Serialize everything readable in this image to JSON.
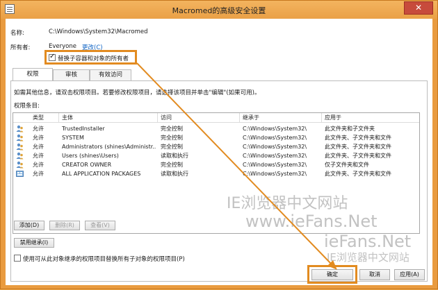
{
  "window": {
    "title": "Macromed的高级安全设置",
    "close_glyph": "✕"
  },
  "info": {
    "name_label": "名称:",
    "name_value": "C:\\Windows\\System32\\Macromed",
    "owner_label": "所有者:",
    "owner_value": "Everyone",
    "change_link": "更改(C)",
    "replace_owner_label": "替换子容器和对象的所有者",
    "replace_owner_checked": true
  },
  "tabs": [
    {
      "label": "权限",
      "active": true
    },
    {
      "label": "审核",
      "active": false
    },
    {
      "label": "有效访问",
      "active": false
    }
  ],
  "instructions": "如需其他信息，请双击权限项目。若要修改权限项目，请选择该项目并单击\"编辑\"(如果可用)。",
  "entries_label": "权限条目:",
  "columns": [
    "类型",
    "主体",
    "访问",
    "继承于",
    "应用于"
  ],
  "rows": [
    {
      "type": "允许",
      "principal": "TrustedInstaller",
      "access": "完全控制",
      "inherited": "C:\\Windows\\System32\\",
      "applies": "此文件夹和子文件夹",
      "icon": "user-icon"
    },
    {
      "type": "允许",
      "principal": "SYSTEM",
      "access": "完全控制",
      "inherited": "C:\\Windows\\System32\\",
      "applies": "此文件夹、子文件夹和文件",
      "icon": "user-icon"
    },
    {
      "type": "允许",
      "principal": "Administrators (shines\\Administr...",
      "access": "完全控制",
      "inherited": "C:\\Windows\\System32\\",
      "applies": "此文件夹、子文件夹和文件",
      "icon": "user-icon"
    },
    {
      "type": "允许",
      "principal": "Users (shines\\Users)",
      "access": "读取和执行",
      "inherited": "C:\\Windows\\System32\\",
      "applies": "此文件夹、子文件夹和文件",
      "icon": "user-icon"
    },
    {
      "type": "允许",
      "principal": "CREATOR OWNER",
      "access": "完全控制",
      "inherited": "C:\\Windows\\System32\\",
      "applies": "仅子文件夹和文件",
      "icon": "user-icon"
    },
    {
      "type": "允许",
      "principal": "ALL APPLICATION PACKAGES",
      "access": "读取和执行",
      "inherited": "C:\\Windows\\System32\\",
      "applies": "此文件夹、子文件夹和文件",
      "icon": "package-icon"
    }
  ],
  "buttons": {
    "add": "添加(D)",
    "remove": "删除(R)",
    "view": "查看(V)",
    "disable_inheritance": "禁用继承(I)",
    "ok": "确定",
    "cancel": "取消",
    "apply": "应用(A)"
  },
  "replace_child_label": "使用可从此对象继承的权限项目替换所有子对象的权限项目(P)",
  "replace_child_checked": false,
  "watermark": {
    "line1": "IE浏览器中文网站",
    "line2": "www.ieFans.Net",
    "line3": "ieFans.Net",
    "line4": "IE浏览器中文网站"
  },
  "colors": {
    "frame": "#e99b3f",
    "highlight": "#e28b20",
    "link": "#0b61c4"
  }
}
